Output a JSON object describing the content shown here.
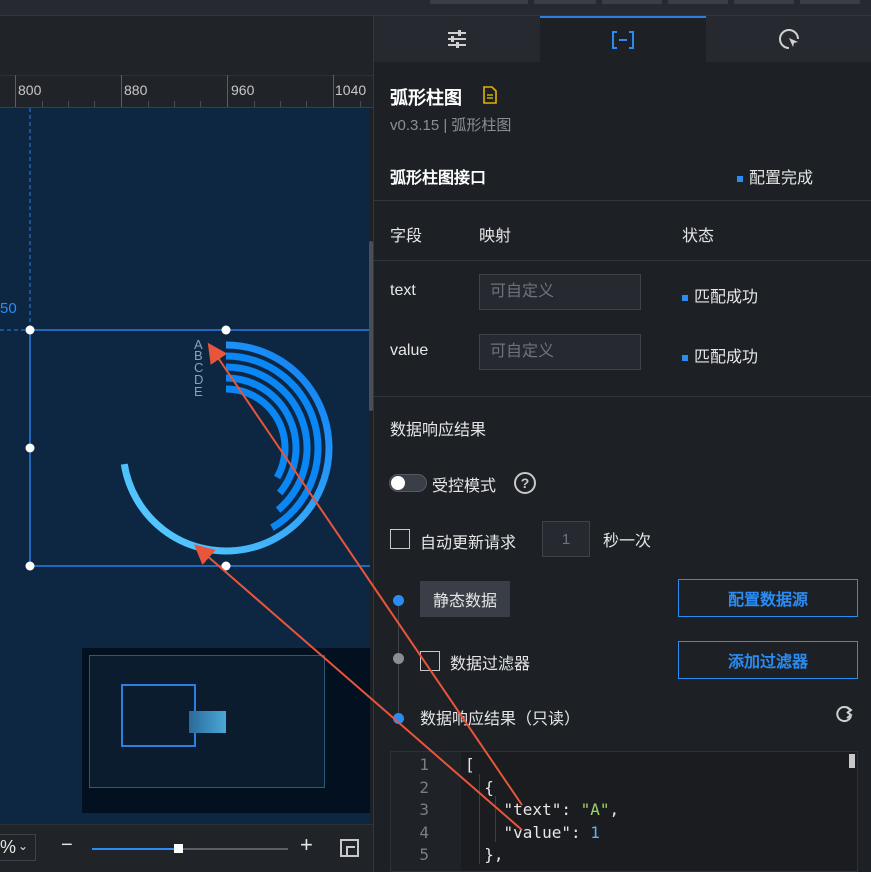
{
  "ruler": {
    "ticks": [
      "800",
      "880",
      "960",
      "1040"
    ],
    "left_marker": "50"
  },
  "arc_chart": {
    "labels": [
      "A",
      "B",
      "C",
      "D",
      "E"
    ]
  },
  "zoom": {
    "percent_fragment": "%"
  },
  "tabs": [
    {
      "name": "settings",
      "icon": "sliders-icon"
    },
    {
      "name": "data",
      "icon": "data-bracket-icon",
      "active": true
    },
    {
      "name": "interaction",
      "icon": "cursor-click-icon"
    }
  ],
  "component": {
    "title": "弧形柱图",
    "subtitle": "v0.3.15 | 弧形柱图"
  },
  "interface": {
    "title": "弧形柱图接口",
    "status": "配置完成",
    "headers": {
      "field": "字段",
      "mapping": "映射",
      "status": "状态"
    },
    "rows": [
      {
        "field": "text",
        "placeholder": "可自定义",
        "status": "匹配成功"
      },
      {
        "field": "value",
        "placeholder": "可自定义",
        "status": "匹配成功"
      }
    ]
  },
  "response": {
    "section_title": "数据响应结果",
    "controlled_mode_label": "受控模式",
    "help": "?",
    "auto_update_label": "自动更新请求",
    "interval_value": "1",
    "per_label": "秒一次",
    "static_data_label": "静态数据",
    "configure_source_label": "配置数据源",
    "filter_label": "数据过滤器",
    "add_filter_label": "添加过滤器",
    "result_label": "数据响应结果（只读）"
  },
  "code": {
    "line_numbers": [
      "1",
      "2",
      "3",
      "4",
      "5"
    ],
    "lines": [
      "[",
      "  {",
      "    \"text\": \"A\",",
      "    \"value\": 1",
      "  },"
    ],
    "text_key": "\"text\"",
    "text_value": "\"A\"",
    "value_key": "\"value\"",
    "value_value": "1"
  },
  "colors": {
    "accent": "#2a8bf2",
    "stage_bg": "#0d2743",
    "arrow": "#e8553a",
    "code_string": "#9fd36b",
    "code_number": "#5cb3f5"
  }
}
